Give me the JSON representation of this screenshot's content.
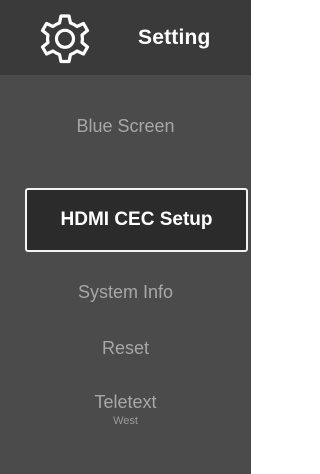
{
  "header": {
    "title": "Setting",
    "icon": "gear-icon"
  },
  "menu": {
    "items": [
      {
        "label": "Blue Screen"
      },
      {
        "label": "HDMI CEC Setup",
        "selected": true
      },
      {
        "label": "System Info"
      },
      {
        "label": "Reset"
      },
      {
        "label": "Teletext",
        "value": "West"
      }
    ]
  },
  "colors": {
    "background": "#4b4b4b",
    "header_background": "#3a3a3a",
    "selected_background": "#2b2b2b",
    "selected_border": "#f2f2f2",
    "text_selected": "#ffffff",
    "text_dim": "#a7a7a7"
  }
}
